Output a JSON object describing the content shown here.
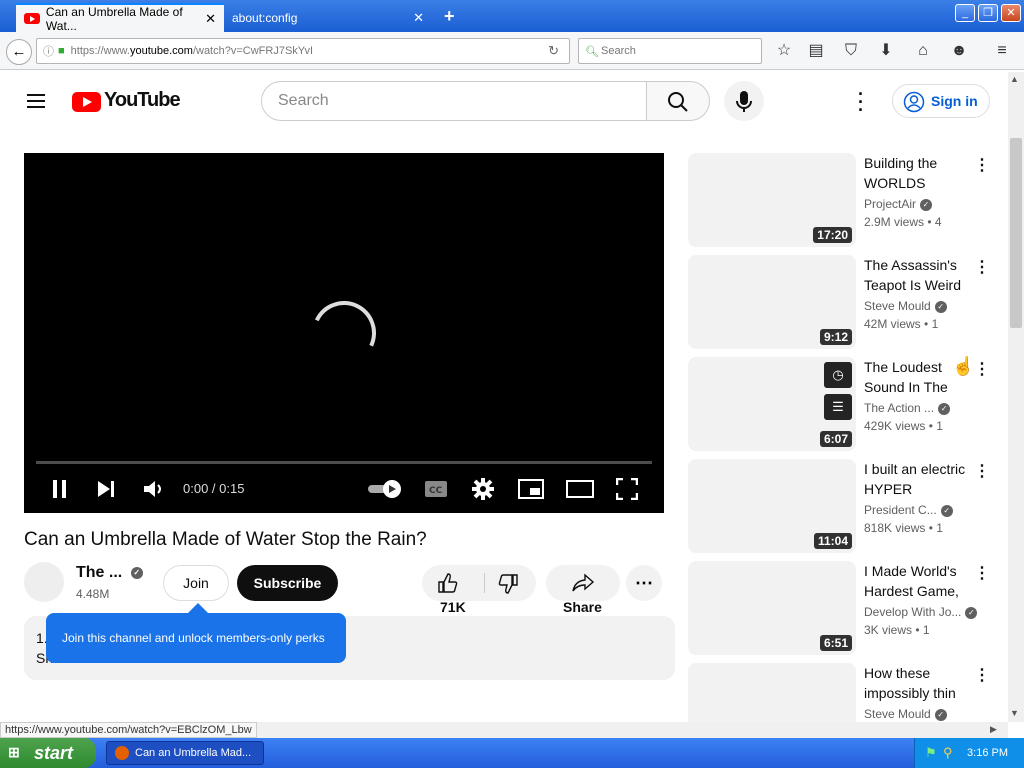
{
  "browser": {
    "tabs": [
      {
        "label": "Can an Umbrella Made of Wat..."
      },
      {
        "label": "about:config"
      }
    ],
    "url_prefix": "https://www.",
    "url_domain": "youtube.com",
    "url_rest": "/watch?v=CwFRJ7SkYvI",
    "search_placeholder": "Search",
    "status_url": "https://www.youtube.com/watch?v=EBClzOM_Lbw"
  },
  "youtube": {
    "logo_text": "YouTube",
    "search_placeholder": "Search",
    "signin_label": "Sign in"
  },
  "player": {
    "time": "0:00 / 0:15"
  },
  "video": {
    "title": "Can an Umbrella Made of Water Stop the Rain?",
    "channel_name": "The ...",
    "subscribers": "4.48M",
    "join_label": "Join",
    "subscribe_label": "Subscribe",
    "likes": "71K",
    "share_label": "Share",
    "desc_line1": "1.",
    "desc_line2": "Sh",
    "tooltip": "Join this channel and unlock members-only perks"
  },
  "recommendations": [
    {
      "title": "Building the WORLDS",
      "channel": "ProjectAir",
      "views": "2.9M views",
      "age": "• 4",
      "duration": "17:20"
    },
    {
      "title": "The Assassin's Teapot Is Weird",
      "channel": "Steve Mould",
      "views": "42M views",
      "age": "• 1",
      "duration": "9:12"
    },
    {
      "title": "The Loudest Sound In The",
      "channel": "The Action ...",
      "views": "429K views",
      "age": "• 1",
      "duration": "6:07"
    },
    {
      "title": "I built an electric HYPER",
      "channel": "President C...",
      "views": "818K views",
      "age": "• 1",
      "duration": "11:04"
    },
    {
      "title": "I Made World's Hardest Game,",
      "channel": "Develop With Jo...",
      "views": "3K views",
      "age": "• 1",
      "duration": "6:51"
    },
    {
      "title": "How these impossibly thin",
      "channel": "Steve Mould",
      "views": "",
      "age": "",
      "duration": ""
    }
  ],
  "taskbar": {
    "start_label": "start",
    "window_label": "Can an Umbrella Mad...",
    "clock": "3:16 PM"
  }
}
